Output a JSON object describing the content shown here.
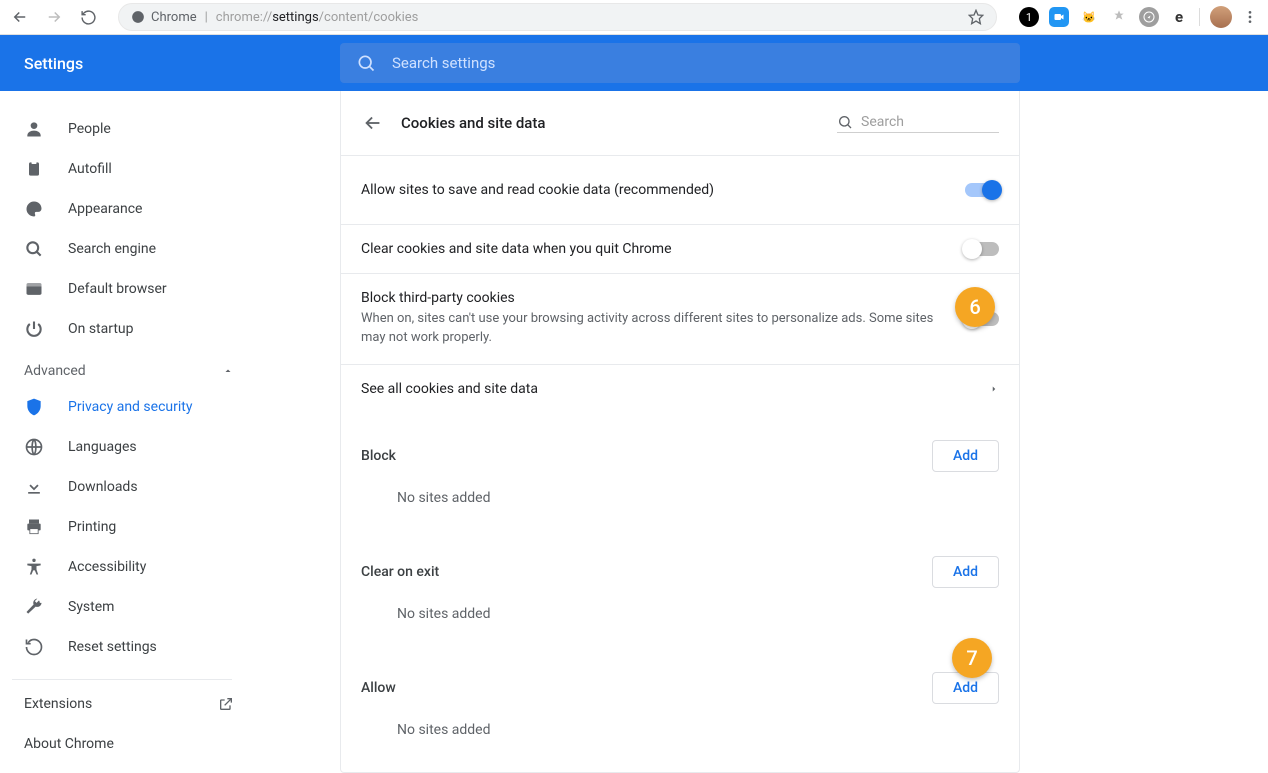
{
  "browser": {
    "url_host": "Chrome",
    "url_path_dim1": "chrome://",
    "url_path_strong": "settings",
    "url_path_dim2": "/content/cookies"
  },
  "header": {
    "title": "Settings",
    "search_placeholder": "Search settings"
  },
  "sidebar": {
    "items": [
      {
        "label": "People"
      },
      {
        "label": "Autofill"
      },
      {
        "label": "Appearance"
      },
      {
        "label": "Search engine"
      },
      {
        "label": "Default browser"
      },
      {
        "label": "On startup"
      }
    ],
    "advanced_label": "Advanced",
    "advanced_items": [
      {
        "label": "Privacy and security"
      },
      {
        "label": "Languages"
      },
      {
        "label": "Downloads"
      },
      {
        "label": "Printing"
      },
      {
        "label": "Accessibility"
      },
      {
        "label": "System"
      },
      {
        "label": "Reset settings"
      }
    ],
    "footer": {
      "extensions": "Extensions",
      "about": "About Chrome"
    }
  },
  "page": {
    "title": "Cookies and site data",
    "search_placeholder": "Search",
    "rows": {
      "allow_cookies": {
        "label": "Allow sites to save and read cookie data (recommended)",
        "on": true
      },
      "clear_on_quit": {
        "label": "Clear cookies and site data when you quit Chrome",
        "on": false
      },
      "block_third_party": {
        "label": "Block third-party cookies",
        "sub": "When on, sites can't use your browsing activity across different sites to personalize ads. Some sites may not work properly.",
        "on": false
      },
      "see_all": {
        "label": "See all cookies and site data"
      }
    },
    "sections": {
      "block": {
        "title": "Block",
        "add": "Add",
        "empty": "No sites added"
      },
      "clear_on_exit": {
        "title": "Clear on exit",
        "add": "Add",
        "empty": "No sites added"
      },
      "allow": {
        "title": "Allow",
        "add": "Add",
        "empty": "No sites added"
      }
    }
  },
  "annotations": {
    "badge6": "6",
    "badge7": "7"
  }
}
